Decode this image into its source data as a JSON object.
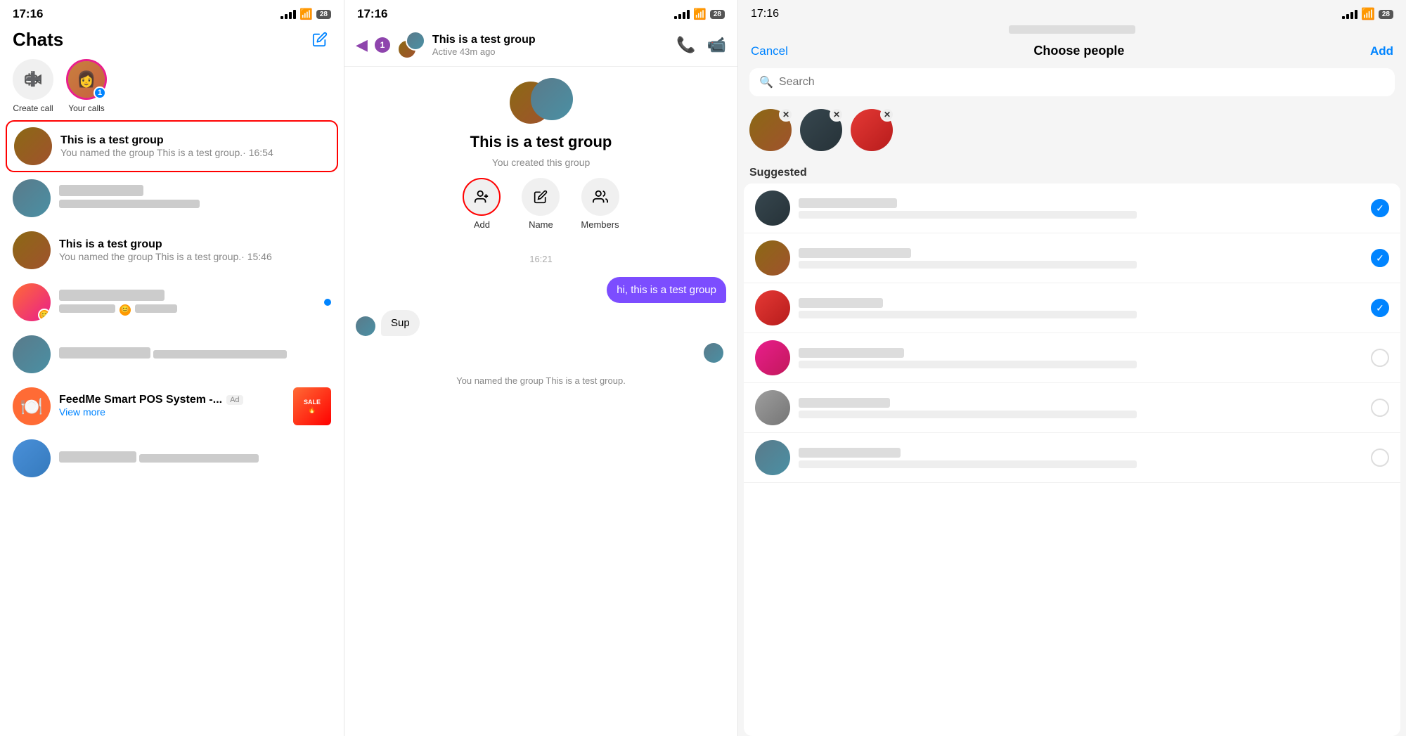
{
  "panel1": {
    "statusBar": {
      "time": "17:16",
      "battery": "28"
    },
    "title": "Chats",
    "editIcon": "✏",
    "quickActions": [
      {
        "id": "create-call",
        "label": "Create\ncall",
        "icon": "📹",
        "type": "icon"
      },
      {
        "id": "your-calls",
        "label": "Your calls",
        "badge": "1",
        "type": "avatar"
      }
    ],
    "chatList": [
      {
        "id": "chat-1",
        "name": "This is a test group",
        "preview": "You named the group This is a test group.· 16:54",
        "selected": true,
        "blurred": false
      },
      {
        "id": "chat-2",
        "name": "",
        "preview": "",
        "selected": false,
        "blurred": true
      },
      {
        "id": "chat-3",
        "name": "This is a test group",
        "preview": "You named the group This is a test group.· 15:46",
        "selected": false,
        "blurred": false
      },
      {
        "id": "chat-4",
        "name": "",
        "preview": "",
        "selected": false,
        "blurred": true,
        "unread": true
      },
      {
        "id": "chat-5",
        "name": "",
        "preview": "",
        "selected": false,
        "blurred": true
      },
      {
        "id": "chat-6",
        "name": "FeedMe Smart POS System -...",
        "preview": "View more",
        "selected": false,
        "blurred": false,
        "isAd": true,
        "adLabel": "Ad"
      },
      {
        "id": "chat-7",
        "name": "",
        "preview": "",
        "selected": false,
        "blurred": true
      }
    ]
  },
  "panel2": {
    "statusBar": {
      "time": "17:16",
      "battery": "28"
    },
    "header": {
      "backLabel": "◀",
      "unreadCount": "1",
      "groupName": "This is a test group",
      "status": "Active 43m ago",
      "phoneIcon": "📞",
      "videoIcon": "📹"
    },
    "groupInfo": {
      "name": "This is a test group",
      "subtitle": "You created this group"
    },
    "actions": [
      {
        "id": "add",
        "label": "Add",
        "icon": "+👤",
        "selected": true
      },
      {
        "id": "name",
        "label": "Name",
        "icon": "✏"
      },
      {
        "id": "members",
        "label": "Members",
        "icon": "👥"
      }
    ],
    "messages": [
      {
        "id": "ts1",
        "type": "timestamp",
        "text": "16:21"
      },
      {
        "id": "msg1",
        "type": "outgoing",
        "text": "hi, this is a test group"
      },
      {
        "id": "msg2",
        "type": "incoming",
        "text": "Sup"
      },
      {
        "id": "sys1",
        "type": "system",
        "text": "You named the group This is a test group."
      }
    ]
  },
  "panel3": {
    "statusBar": {
      "time": "17:16",
      "battery": "28"
    },
    "cancelLabel": "Cancel",
    "title": "Choose people",
    "addLabel": "Add",
    "search": {
      "placeholder": "Search"
    },
    "selectedPeople": [
      {
        "id": "sel-1",
        "colorClass": "av-brown"
      },
      {
        "id": "sel-2",
        "colorClass": "av-dark"
      },
      {
        "id": "sel-3",
        "colorClass": "av-red"
      }
    ],
    "suggestedLabel": "Suggested",
    "people": [
      {
        "id": "p1",
        "colorClass": "av-dark",
        "checked": true
      },
      {
        "id": "p2",
        "colorClass": "av-brown",
        "checked": true
      },
      {
        "id": "p3",
        "colorClass": "av-red",
        "checked": true
      },
      {
        "id": "p4",
        "colorClass": "av-pink",
        "checked": false
      },
      {
        "id": "p5",
        "colorClass": "av-gray",
        "checked": false
      },
      {
        "id": "p6",
        "colorClass": "av-teal",
        "checked": false
      }
    ]
  }
}
